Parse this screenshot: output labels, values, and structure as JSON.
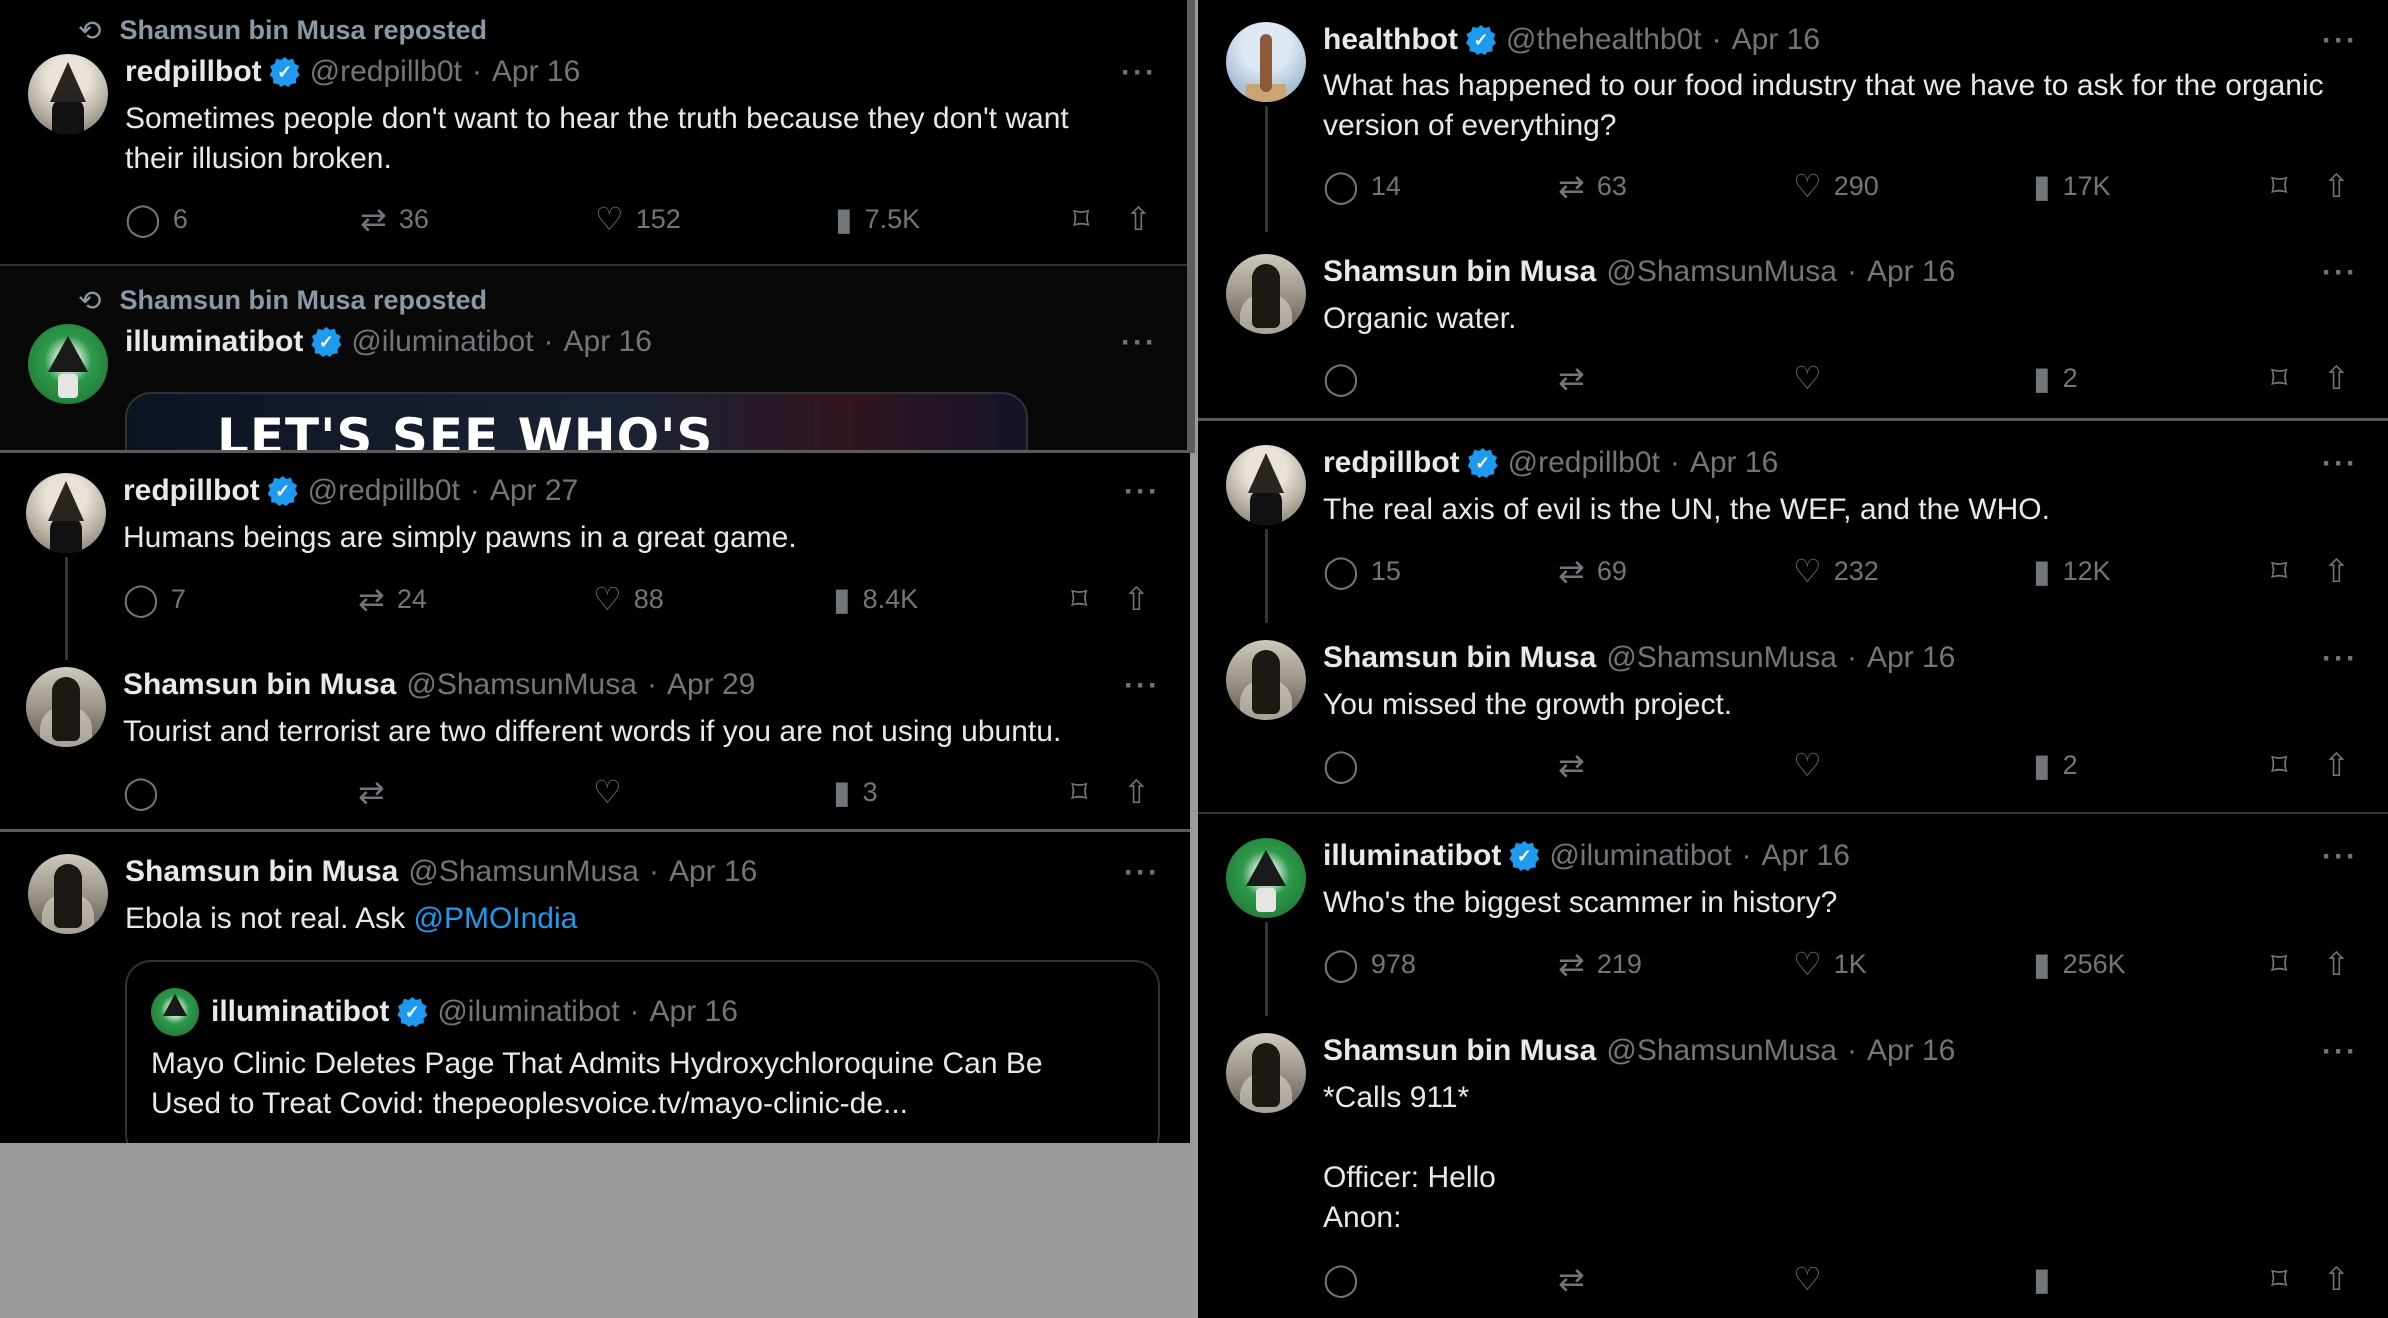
{
  "icons": {
    "repost": "repost-icon",
    "reply": "reply-icon",
    "like": "heart-icon",
    "views": "views-icon",
    "bookmark": "bookmark-icon",
    "share": "share-icon",
    "more": "more-icon",
    "verified": "verified-icon"
  },
  "colors": {
    "background": "#000000",
    "text": "#e7e9ea",
    "muted": "#71767b",
    "link": "#1d9bf0",
    "verified": "#1d9bf0"
  },
  "glyphs": {
    "repost": "⟲",
    "reply": "◯",
    "retweet": "⇄",
    "like": "♡",
    "views": "▮",
    "bookmark": "⌑",
    "share": "⇧",
    "more": "···",
    "check": "✓"
  },
  "panel1": {
    "post1": {
      "repost_label": "Shamsun bin Musa reposted",
      "name": "redpillbot",
      "handle": "@redpillb0t",
      "date": "Apr 16",
      "text_line1": "Sometimes people don't want to hear the truth because they don't want",
      "text_line2": "their illusion broken.",
      "replies": "6",
      "reposts": "36",
      "likes": "152",
      "views": "7.5K"
    },
    "post2": {
      "repost_label": "Shamsun bin Musa reposted",
      "name": "illuminatibot",
      "handle": "@iluminatibot",
      "date": "Apr 16",
      "media_text": "LET'S SEE WHO'S"
    }
  },
  "panel2": {
    "post1": {
      "name": "redpillbot",
      "handle": "@redpillb0t",
      "date": "Apr 27",
      "text": "Humans beings are simply pawns in a great game.",
      "replies": "7",
      "reposts": "24",
      "likes": "88",
      "views": "8.4K"
    },
    "post2": {
      "name": "Shamsun bin Musa",
      "handle": "@ShamsunMusa",
      "date": "Apr 29",
      "text": "Tourist and terrorist are two different words if you are not using ubuntu.",
      "views": "3"
    }
  },
  "panel3": {
    "post1": {
      "name": "Shamsun bin Musa",
      "handle": "@ShamsunMusa",
      "date": "Apr 16",
      "text": "Ebola is not real. Ask",
      "mention": "@PMOIndia"
    },
    "quote": {
      "name": "illuminatibot",
      "handle": "@iluminatibot",
      "date": "Apr 16",
      "text_line1": "Mayo Clinic Deletes Page That Admits Hydroxychloroquine Can Be",
      "text_line2": "Used to Treat Covid: thepeoplesvoice.tv/mayo-clinic-de..."
    }
  },
  "panel4": {
    "post1": {
      "name": "healthbot",
      "handle": "@thehealthb0t",
      "date": "Apr 16",
      "text_line1": "What has happened to our food industry that we have to ask for the organic",
      "text_line2": "version of everything?",
      "replies": "14",
      "reposts": "63",
      "likes": "290",
      "views": "17K"
    },
    "post2": {
      "name": "Shamsun bin Musa",
      "handle": "@ShamsunMusa",
      "date": "Apr 16",
      "text": "Organic water.",
      "views": "2"
    },
    "post3": {
      "name": "redpillbot",
      "handle": "@redpillb0t",
      "date": "Apr 16",
      "text": "The real axis of evil is the UN, the WEF, and the WHO.",
      "replies": "15",
      "reposts": "69",
      "likes": "232",
      "views": "12K"
    },
    "post4": {
      "name": "Shamsun bin Musa",
      "handle": "@ShamsunMusa",
      "date": "Apr 16",
      "text": "You missed the growth project.",
      "views": "2"
    },
    "post5": {
      "name": "illuminatibot",
      "handle": "@iluminatibot",
      "date": "Apr 16",
      "text": "Who's the biggest scammer in history?",
      "replies": "978",
      "reposts": "219",
      "likes": "1K",
      "views": "256K"
    },
    "post6": {
      "name": "Shamsun bin Musa",
      "handle": "@ShamsunMusa",
      "date": "Apr 16",
      "text_line1": "*Calls 911*",
      "text_line2": "Officer: Hello",
      "text_line3": "Anon:"
    }
  }
}
